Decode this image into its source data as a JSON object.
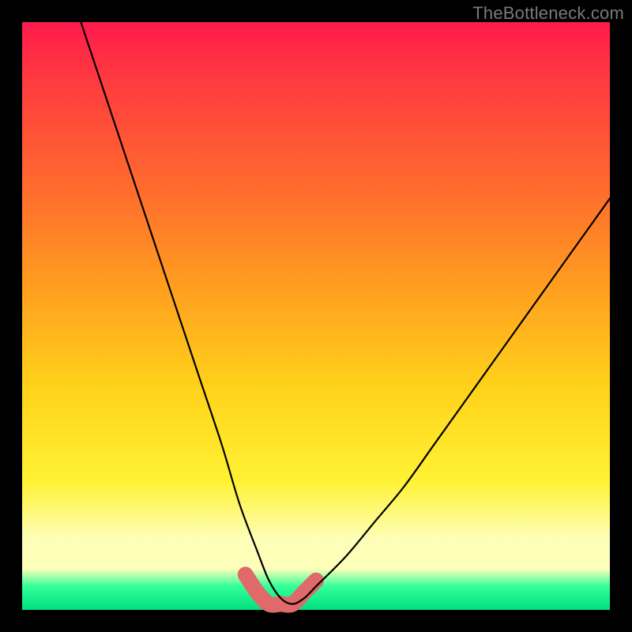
{
  "watermark": "TheBottleneck.com",
  "chart_data": {
    "type": "line",
    "title": "",
    "xlabel": "",
    "ylabel": "",
    "xlim": [
      0,
      100
    ],
    "ylim": [
      0,
      100
    ],
    "series": [
      {
        "name": "bottleneck-curve",
        "x": [
          10,
          14,
          18,
          22,
          26,
          30,
          34,
          37,
          40,
          42,
          44,
          46,
          48,
          50,
          55,
          60,
          65,
          70,
          75,
          80,
          85,
          90,
          95,
          100
        ],
        "y": [
          100,
          88,
          76,
          64,
          52,
          40,
          28,
          18,
          10,
          5,
          2,
          1,
          2,
          4,
          9,
          15,
          21,
          28,
          35,
          42,
          49,
          56,
          63,
          70
        ]
      },
      {
        "name": "highlight-band",
        "x": [
          38,
          40,
          42,
          44,
          46,
          48,
          50
        ],
        "y": [
          6,
          3,
          1,
          1,
          1,
          3,
          5
        ]
      }
    ],
    "colors": {
      "gradient_top": "#ff1a4d",
      "gradient_mid": "#ffd21a",
      "gradient_bottom": "#00e081",
      "curve": "#000000",
      "highlight": "#e06a6a"
    }
  }
}
